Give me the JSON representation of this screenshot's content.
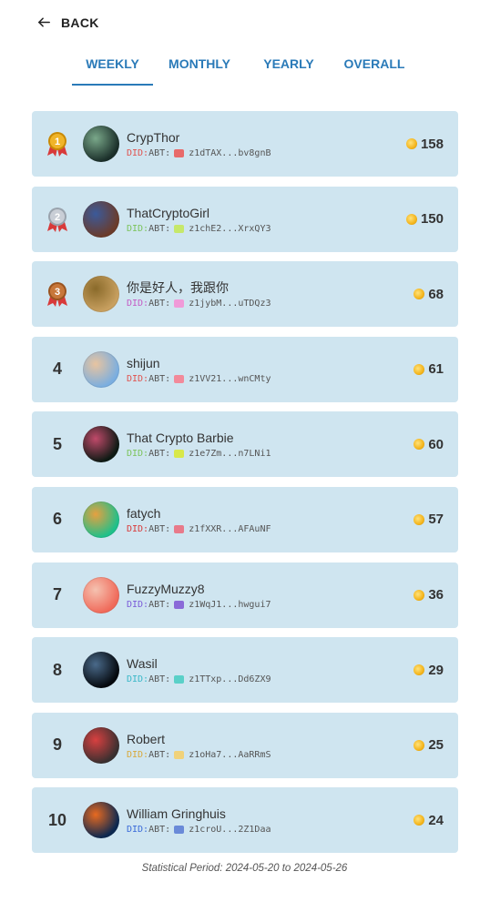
{
  "nav": {
    "back_label": "BACK"
  },
  "tabs": [
    {
      "label": "WEEKLY",
      "active": true
    },
    {
      "label": "MONTHLY",
      "active": false
    },
    {
      "label": "YEARLY",
      "active": false
    },
    {
      "label": "OVERALL",
      "active": false
    }
  ],
  "leaderboard": [
    {
      "rank": "1",
      "medal": "gold",
      "name": "CrypThor",
      "did_prefix": "DID:ABT:",
      "did": "z1dTAX...bv8gnB",
      "score": "158",
      "prefix_color": "#e0524e",
      "badge_color": "#e86a6a",
      "avatar": [
        "#1b2f2a",
        "#7aa88a"
      ]
    },
    {
      "rank": "2",
      "medal": "silver",
      "name": "ThatCryptoGirl",
      "did_prefix": "DID:ABT:",
      "did": "z1chE2...XrxQY3",
      "score": "150",
      "prefix_color": "#7cc35b",
      "badge_color": "#c6e86a",
      "avatar": [
        "#6b3b2a",
        "#3b5a9a"
      ]
    },
    {
      "rank": "3",
      "medal": "bronze",
      "name": "你是好人，我跟你",
      "did_prefix": "DID:ABT:",
      "did": "z1jybM...uTDQz3",
      "score": "68",
      "prefix_color": "#c45ac4",
      "badge_color": "#f09ad8",
      "avatar": [
        "#c8a060",
        "#8a6a2a"
      ]
    },
    {
      "rank": "4",
      "medal": "",
      "name": "shijun",
      "did_prefix": "DID:ABT:",
      "did": "z1VV21...wnCMty",
      "score": "61",
      "prefix_color": "#e0524e",
      "badge_color": "#f28a9a",
      "avatar": [
        "#7aaee0",
        "#e8c4a0"
      ]
    },
    {
      "rank": "5",
      "medal": "",
      "name": "That Crypto Barbie",
      "did_prefix": "DID:ABT:",
      "did": "z1e7Zm...n7LNi1",
      "score": "60",
      "prefix_color": "#7cc35b",
      "badge_color": "#d8e84a",
      "avatar": [
        "#0e1a14",
        "#c04a6a"
      ]
    },
    {
      "rank": "6",
      "medal": "",
      "name": "fatych",
      "did_prefix": "DID:ABT:",
      "did": "z1fXXR...AFAuNF",
      "score": "57",
      "prefix_color": "#d83a3a",
      "badge_color": "#e87a8a",
      "avatar": [
        "#1ec08a",
        "#e6a040"
      ]
    },
    {
      "rank": "7",
      "medal": "",
      "name": "FuzzyMuzzy8",
      "did_prefix": "DID:ABT:",
      "did": "z1WqJ1...hwgui7",
      "score": "36",
      "prefix_color": "#7a5ad8",
      "badge_color": "#8a6ad8",
      "avatar": [
        "#f06a5a",
        "#f5c2b0"
      ]
    },
    {
      "rank": "8",
      "medal": "",
      "name": "Wasil",
      "did_prefix": "DID:ABT:",
      "did": "z1TTxp...Dd6ZX9",
      "score": "29",
      "prefix_color": "#3ab8c8",
      "badge_color": "#5ad0c8",
      "avatar": [
        "#05090e",
        "#4a6a8a"
      ]
    },
    {
      "rank": "9",
      "medal": "",
      "name": "Robert",
      "did_prefix": "DID:ABT:",
      "did": "z1oHa7...AaRRmS",
      "score": "25",
      "prefix_color": "#d8a83a",
      "badge_color": "#f0d27a",
      "avatar": [
        "#3a3030",
        "#d84040"
      ]
    },
    {
      "rank": "10",
      "medal": "",
      "name": "William Gringhuis",
      "did_prefix": "DID:ABT:",
      "did": "z1croU...2Z1Daa",
      "score": "24",
      "prefix_color": "#3a6ad8",
      "badge_color": "#6a8ad8",
      "avatar": [
        "#0c2850",
        "#e86a20"
      ]
    }
  ],
  "footer": {
    "period": "Statistical Period: 2024-05-20 to 2024-05-26"
  }
}
